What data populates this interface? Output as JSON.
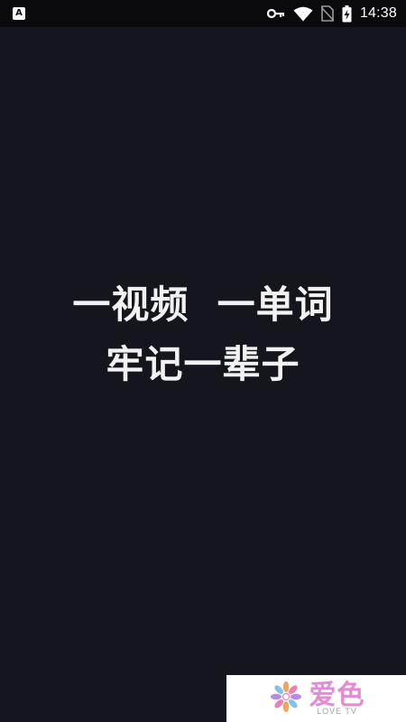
{
  "status_bar": {
    "notification_icon_letter": "A",
    "icons": [
      "vpn-key-icon",
      "wifi-icon",
      "no-sim-icon",
      "battery-charging-icon"
    ],
    "time": "14:38"
  },
  "slogan": {
    "line1": "一视频  一单词",
    "line2": "牢记一辈子"
  },
  "logo": {
    "text_cn": "爱色",
    "text_en": "LOVE TV",
    "colors": {
      "primary": "#e58bd2",
      "flower_orange": "#f5a25a",
      "flower_pink": "#ef7fb5",
      "flower_blue": "#7fc3e8",
      "flower_purple": "#b58be3"
    }
  },
  "colors": {
    "background": "#14151d",
    "status_bar": "#0a0a0d",
    "text": "#f2f2f2"
  }
}
